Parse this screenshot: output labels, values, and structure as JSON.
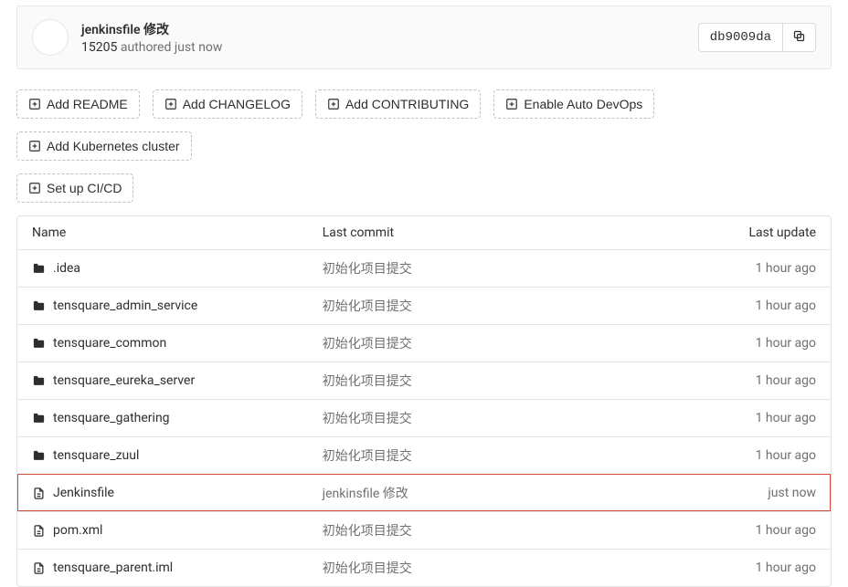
{
  "commit": {
    "title": "jenkinsfile 修改",
    "author": "15205",
    "authored_text": "authored just now",
    "sha": "db9009da"
  },
  "suggestions": {
    "row1": [
      "Add README",
      "Add CHANGELOG",
      "Add CONTRIBUTING",
      "Enable Auto DevOps",
      "Add Kubernetes cluster"
    ],
    "row2": [
      "Set up CI/CD"
    ]
  },
  "table": {
    "headers": {
      "name": "Name",
      "commit": "Last commit",
      "update": "Last update"
    },
    "rows": [
      {
        "icon": "folder",
        "name": ".idea",
        "commit": "初始化项目提交",
        "update": "1 hour ago",
        "highlight": false
      },
      {
        "icon": "folder",
        "name": "tensquare_admin_service",
        "commit": "初始化项目提交",
        "update": "1 hour ago",
        "highlight": false
      },
      {
        "icon": "folder",
        "name": "tensquare_common",
        "commit": "初始化项目提交",
        "update": "1 hour ago",
        "highlight": false
      },
      {
        "icon": "folder",
        "name": "tensquare_eureka_server",
        "commit": "初始化项目提交",
        "update": "1 hour ago",
        "highlight": false
      },
      {
        "icon": "folder",
        "name": "tensquare_gathering",
        "commit": "初始化项目提交",
        "update": "1 hour ago",
        "highlight": false
      },
      {
        "icon": "folder",
        "name": "tensquare_zuul",
        "commit": "初始化项目提交",
        "update": "1 hour ago",
        "highlight": false
      },
      {
        "icon": "file",
        "name": "Jenkinsfile",
        "commit": "jenkinsfile 修改",
        "update": "just now",
        "highlight": true
      },
      {
        "icon": "file",
        "name": "pom.xml",
        "commit": "初始化项目提交",
        "update": "1 hour ago",
        "highlight": false
      },
      {
        "icon": "file",
        "name": "tensquare_parent.iml",
        "commit": "初始化项目提交",
        "update": "1 hour ago",
        "highlight": false
      }
    ]
  }
}
